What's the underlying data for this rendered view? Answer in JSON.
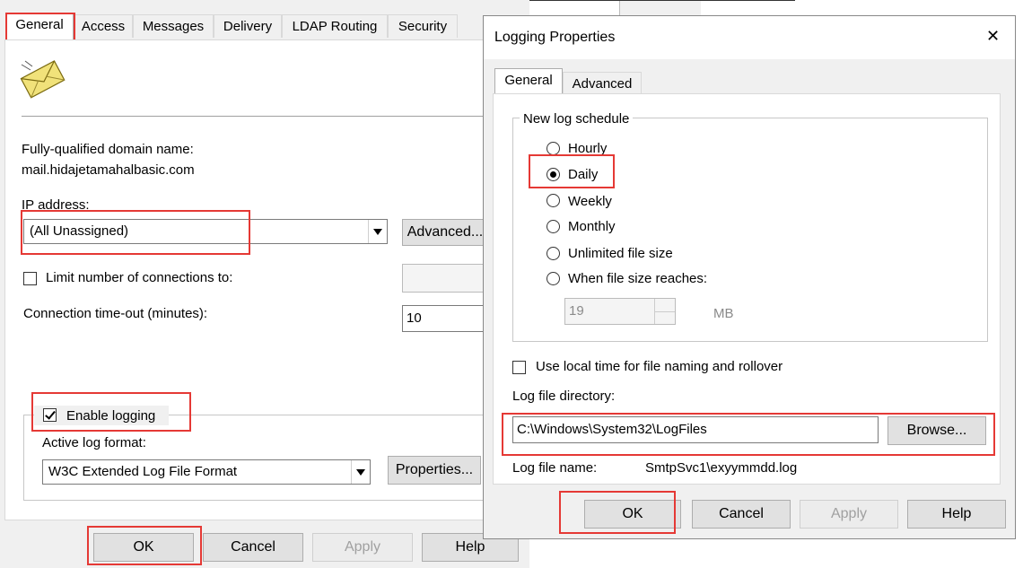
{
  "back_dialog": {
    "tabs": [
      {
        "label": "General",
        "active": true
      },
      {
        "label": "Access"
      },
      {
        "label": "Messages"
      },
      {
        "label": "Delivery"
      },
      {
        "label": "LDAP Routing"
      },
      {
        "label": "Security"
      }
    ],
    "fqdn_label": "Fully-qualified domain name:",
    "fqdn_value": "mail.hidajetamahalbasic.com",
    "ip_label": "IP address:",
    "ip_value": "(All Unassigned)",
    "advanced_button": "Advanced...",
    "limit_label": "Limit number of connections to:",
    "timeout_label": "Connection time-out (minutes):",
    "timeout_value": "10",
    "enable_logging_label": "Enable logging",
    "active_log_format_label": "Active log format:",
    "log_format_value": "W3C Extended Log File Format",
    "properties_button": "Properties...",
    "ok": "OK",
    "cancel": "Cancel",
    "apply": "Apply",
    "help": "Help"
  },
  "logging_dialog": {
    "title": "Logging Properties",
    "close_glyph": "✕",
    "tabs": [
      {
        "label": "General",
        "active": true
      },
      {
        "label": "Advanced"
      }
    ],
    "schedule_group": "New log schedule",
    "schedules": [
      {
        "label": "Hourly",
        "selected": false
      },
      {
        "label": "Daily",
        "selected": true
      },
      {
        "label": "Weekly",
        "selected": false
      },
      {
        "label": "Monthly",
        "selected": false
      },
      {
        "label": "Unlimited file size",
        "selected": false
      },
      {
        "label": "When file size reaches:",
        "selected": false
      }
    ],
    "size_value": "19",
    "size_unit": "MB",
    "local_time_label": "Use local time for file naming and rollover",
    "log_dir_label": "Log file directory:",
    "log_dir_value": "C:\\Windows\\System32\\LogFiles",
    "browse_button": "Browse...",
    "log_name_label": "Log file name:",
    "log_name_value": "SmtpSvc1\\exyymmdd.log",
    "ok": "OK",
    "cancel": "Cancel",
    "apply": "Apply",
    "help": "Help"
  },
  "colors": {
    "highlight": "#e53935",
    "dialog_bg": "#f0f0f0"
  },
  "icons": {
    "mail": "envelope-icon"
  }
}
